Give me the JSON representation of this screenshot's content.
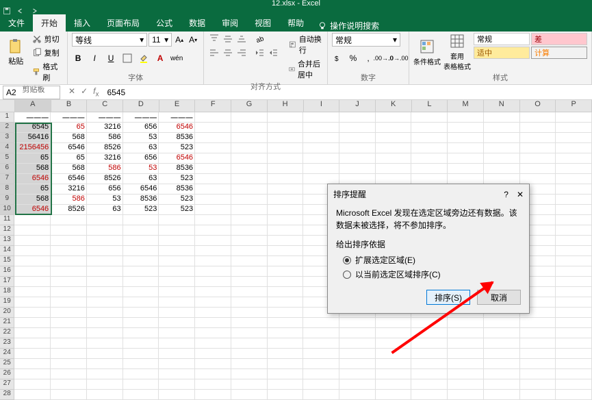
{
  "title": "12.xlsx - Excel",
  "tabs": [
    "文件",
    "开始",
    "插入",
    "页面布局",
    "公式",
    "数据",
    "审阅",
    "视图",
    "帮助"
  ],
  "tellMe": "操作说明搜索",
  "clipboard": {
    "paste": "粘贴",
    "cut": "剪切",
    "copy": "复制",
    "format": "格式刷",
    "label": "剪贴板"
  },
  "font": {
    "name": "等线",
    "size": "11",
    "label": "字体"
  },
  "align": {
    "wrap": "自动换行",
    "merge": "合并后居中",
    "label": "对齐方式"
  },
  "number": {
    "format": "常规",
    "label": "数字"
  },
  "styles": {
    "cond": "条件格式",
    "table": "套用\n表格格式",
    "normal": "常规",
    "bad": "差",
    "neutral": "适中",
    "calc": "计算",
    "label": "样式"
  },
  "nameBox": "A2",
  "formula": "6545",
  "columns": [
    "A",
    "B",
    "C",
    "D",
    "E",
    "F",
    "G",
    "H",
    "I",
    "J",
    "K",
    "L",
    "M",
    "N",
    "O",
    "P"
  ],
  "grid": [
    [
      "一一一",
      "一一一",
      "一一一",
      "一一一",
      "一一一",
      "",
      "",
      "",
      "",
      "",
      "",
      "",
      "",
      "",
      "",
      ""
    ],
    [
      "6545",
      "65",
      "3216",
      "656",
      "6546",
      "",
      "",
      "",
      "",
      "",
      "",
      "",
      "",
      "",
      "",
      ""
    ],
    [
      "56416",
      "568",
      "586",
      "53",
      "8536",
      "",
      "",
      "",
      "",
      "",
      "",
      "",
      "",
      "",
      "",
      ""
    ],
    [
      "2156456",
      "6546",
      "8526",
      "63",
      "523",
      "",
      "",
      "",
      "",
      "",
      "",
      "",
      "",
      "",
      "",
      ""
    ],
    [
      "65",
      "65",
      "3216",
      "656",
      "6546",
      "",
      "",
      "",
      "",
      "",
      "",
      "",
      "",
      "",
      "",
      ""
    ],
    [
      "568",
      "568",
      "586",
      "53",
      "8536",
      "",
      "",
      "",
      "",
      "",
      "",
      "",
      "",
      "",
      "",
      ""
    ],
    [
      "6546",
      "6546",
      "8526",
      "63",
      "523",
      "",
      "",
      "",
      "",
      "",
      "",
      "",
      "",
      "",
      "",
      ""
    ],
    [
      "65",
      "3216",
      "656",
      "6546",
      "8536",
      "",
      "",
      "",
      "",
      "",
      "",
      "",
      "",
      "",
      "",
      ""
    ],
    [
      "568",
      "586",
      "53",
      "8536",
      "523",
      "",
      "",
      "",
      "",
      "",
      "",
      "",
      "",
      "",
      "",
      ""
    ],
    [
      "6546",
      "8526",
      "63",
      "523",
      "523",
      "",
      "",
      "",
      "",
      "",
      "",
      "",
      "",
      "",
      "",
      ""
    ]
  ],
  "redCells": [
    [
      1,
      1
    ],
    [
      1,
      4
    ],
    [
      3,
      0
    ],
    [
      4,
      4
    ],
    [
      5,
      2
    ],
    [
      5,
      3
    ],
    [
      6,
      0
    ],
    [
      8,
      1
    ],
    [
      9,
      0
    ]
  ],
  "dialog": {
    "title": "排序提醒",
    "text": "Microsoft Excel 发现在选定区域旁边还有数据。该数据未被选择，将不参加排序。",
    "give": "给出排序依据",
    "opt1": "扩展选定区域(E)",
    "opt2": "以当前选定区域排序(C)",
    "ok": "排序(S)",
    "cancel": "取消"
  }
}
